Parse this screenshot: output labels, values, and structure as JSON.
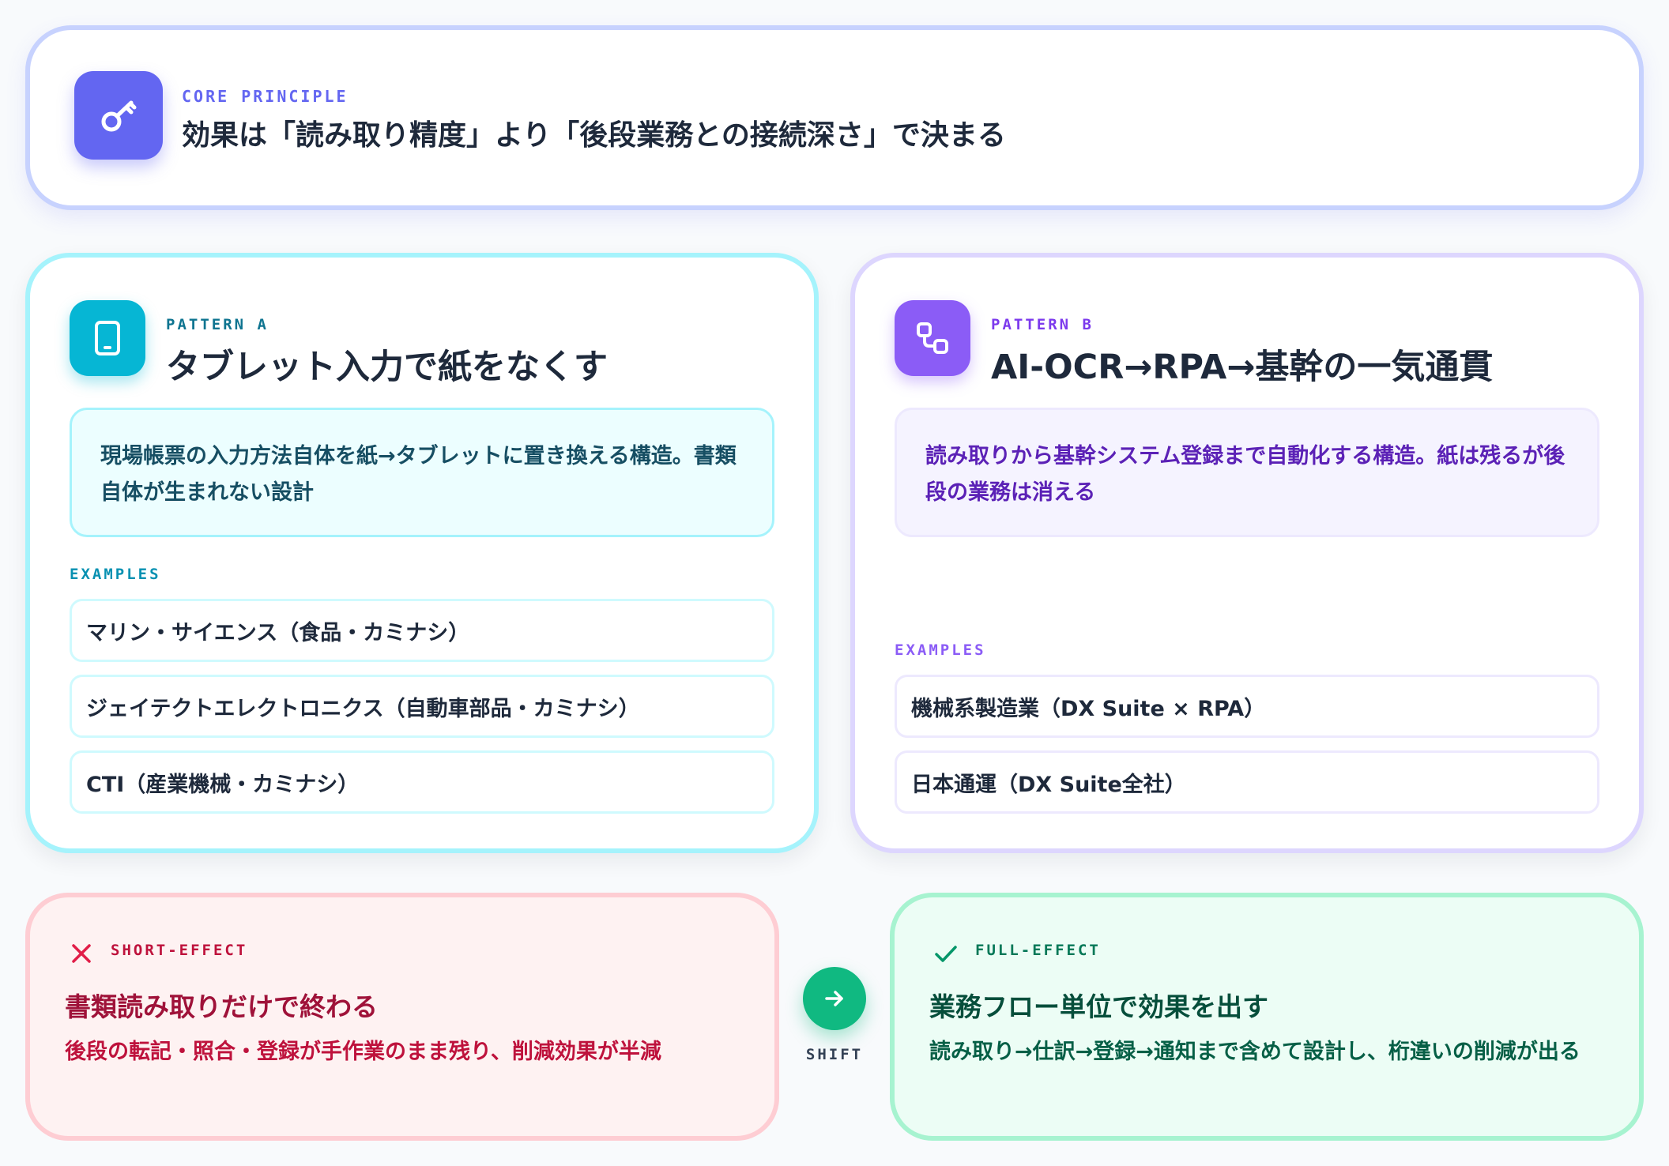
{
  "core": {
    "label": "CORE PRINCIPLE",
    "title": "効果は「読み取り精度」より「後段業務との接続深さ」で決まる",
    "icon": "key-icon",
    "accent": "#6366f1"
  },
  "pattern_a": {
    "label": "PATTERN A",
    "title": "タブレット入力で紙をなくす",
    "icon": "tablet-icon",
    "accent": "#06b6d4",
    "description": "現場帳票の入力方法自体を紙→タブレットに置き換える構造。書類自体が生まれない設計",
    "examples_label": "EXAMPLES",
    "examples": [
      "マリン・サイエンス（食品・カミナシ）",
      "ジェイテクトエレクトロニクス（自動車部品・カミナシ）",
      "CTI（産業機械・カミナシ）"
    ]
  },
  "pattern_b": {
    "label": "PATTERN B",
    "title": "AI-OCR→RPA→基幹の一気通貫",
    "icon": "workflow-icon",
    "accent": "#8b5cf6",
    "description": "読み取りから基幹システム登録まで自動化する構造。紙は残るが後段の業務は消える",
    "examples_label": "EXAMPLES",
    "examples": [
      "機械系製造業（DX Suite × RPA）",
      "日本通運（DX Suite全社）"
    ]
  },
  "short_effect": {
    "label": "SHORT-EFFECT",
    "icon": "x-icon",
    "title": "書類読み取りだけで終わる",
    "description": "後段の転記・照合・登録が手作業のまま残り、削減効果が半減",
    "accent": "#e11d48"
  },
  "shift": {
    "label": "SHIFT",
    "icon": "arrow-right-icon",
    "accent": "#10b981"
  },
  "full_effect": {
    "label": "FULL-EFFECT",
    "icon": "check-icon",
    "title": "業務フロー単位で効果を出す",
    "description": "読み取り→仕訳→登録→通知まで含めて設計し、桁違いの削減が出る",
    "accent": "#059669"
  }
}
